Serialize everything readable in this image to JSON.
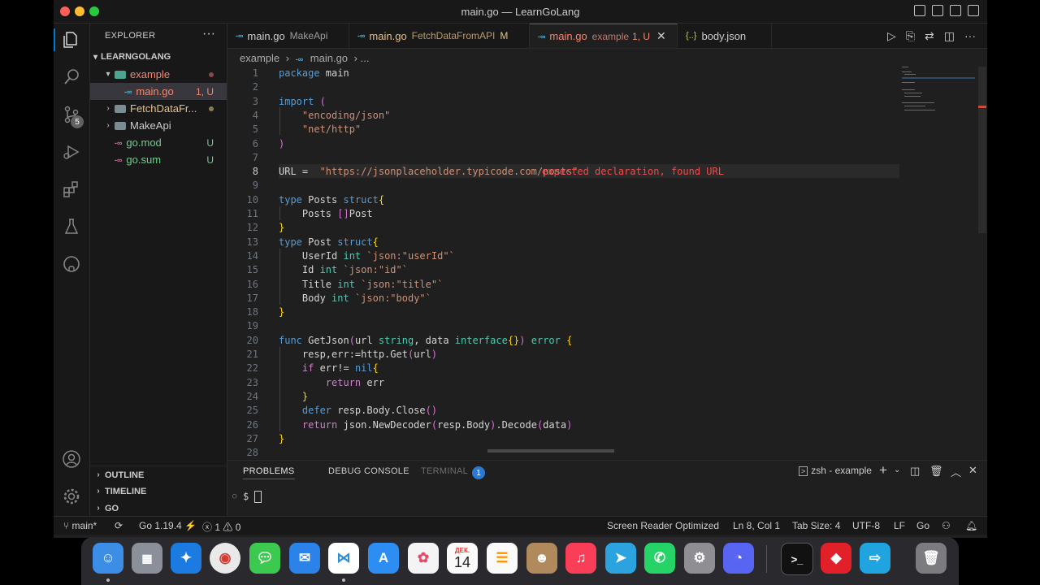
{
  "window": {
    "title": "main.go — LearnGoLang"
  },
  "activitybar": {
    "source_control_badge": "5"
  },
  "explorer": {
    "title": "EXPLORER",
    "more": "···",
    "root": "LEARNGOLANG",
    "items": [
      {
        "label": "example",
        "badge": "",
        "color": "#f48771"
      },
      {
        "label": "main.go",
        "badge": "1, U",
        "color": "#f48771"
      },
      {
        "label": "FetchDataFr...",
        "badge": "",
        "color": "#e2c08d"
      },
      {
        "label": "MakeApi",
        "badge": "",
        "color": "#cccccc"
      },
      {
        "label": "go.mod",
        "badge": "U",
        "color": "#73c991"
      },
      {
        "label": "go.sum",
        "badge": "U",
        "color": "#73c991"
      }
    ],
    "sections": [
      "OUTLINE",
      "TIMELINE",
      "GO"
    ]
  },
  "tabs": [
    {
      "label": "main.go",
      "desc": "MakeApi",
      "status": ""
    },
    {
      "label": "main.go",
      "desc": "FetchDataFromAPI",
      "status": "M"
    },
    {
      "label": "main.go",
      "desc": "example",
      "status": "1, U"
    },
    {
      "label": "body.json",
      "desc": "",
      "status": ""
    }
  ],
  "breadcrumb": {
    "folder": "example",
    "sep": "›",
    "file": "main.go",
    "tail": "›  ..."
  },
  "editor": {
    "active_line": 8,
    "lines": [
      {
        "n": "1",
        "t": "package main"
      },
      {
        "n": "2",
        "t": ""
      },
      {
        "n": "3",
        "t": "import ("
      },
      {
        "n": "4",
        "t": "    \"encoding/json\""
      },
      {
        "n": "5",
        "t": "    \"net/http\""
      },
      {
        "n": "6",
        "t": ")"
      },
      {
        "n": "7",
        "t": ""
      },
      {
        "n": "8",
        "t": "URL =  \"https://jsonplaceholder.typicode.com/posts\""
      },
      {
        "n": "9",
        "t": ""
      },
      {
        "n": "10",
        "t": "type Posts struct{"
      },
      {
        "n": "11",
        "t": "    Posts []Post"
      },
      {
        "n": "12",
        "t": "}"
      },
      {
        "n": "13",
        "t": "type Post struct{"
      },
      {
        "n": "14",
        "t": "    UserId int `json:\"userId\"`"
      },
      {
        "n": "15",
        "t": "    Id int `json:\"id\"`"
      },
      {
        "n": "16",
        "t": "    Title int `json:\"title\"`"
      },
      {
        "n": "17",
        "t": "    Body int `json:\"body\"`"
      },
      {
        "n": "18",
        "t": "}"
      },
      {
        "n": "19",
        "t": ""
      },
      {
        "n": "20",
        "t": "func GetJson(url string, data interface{}) error {"
      },
      {
        "n": "21",
        "t": "    resp,err:=http.Get(url)"
      },
      {
        "n": "22",
        "t": "    if err!= nil{"
      },
      {
        "n": "23",
        "t": "        return err"
      },
      {
        "n": "24",
        "t": "    }"
      },
      {
        "n": "25",
        "t": "    defer resp.Body.Close()"
      },
      {
        "n": "26",
        "t": "    return json.NewDecoder(resp.Body).Decode(data)"
      },
      {
        "n": "27",
        "t": "}"
      },
      {
        "n": "28",
        "t": ""
      }
    ],
    "inline_error": "expected declaration, found URL"
  },
  "panel": {
    "tabs": [
      "PROBLEMS",
      "DEBUG CONSOLE",
      "TERMINAL"
    ],
    "problems_count": "1",
    "terminal_name": "zsh - example",
    "prompt": "$"
  },
  "statusbar": {
    "branch": "main*",
    "go_version": "Go 1.19.4",
    "errors": "1",
    "warnings": "0",
    "screen_reader": "Screen Reader Optimized",
    "position": "Ln 8, Col 1",
    "tab_size": "Tab Size: 4",
    "encoding": "UTF-8",
    "eol": "LF",
    "language": "Go"
  },
  "dock": {
    "calendar_month": "ДЕК.",
    "calendar_day": "14"
  }
}
